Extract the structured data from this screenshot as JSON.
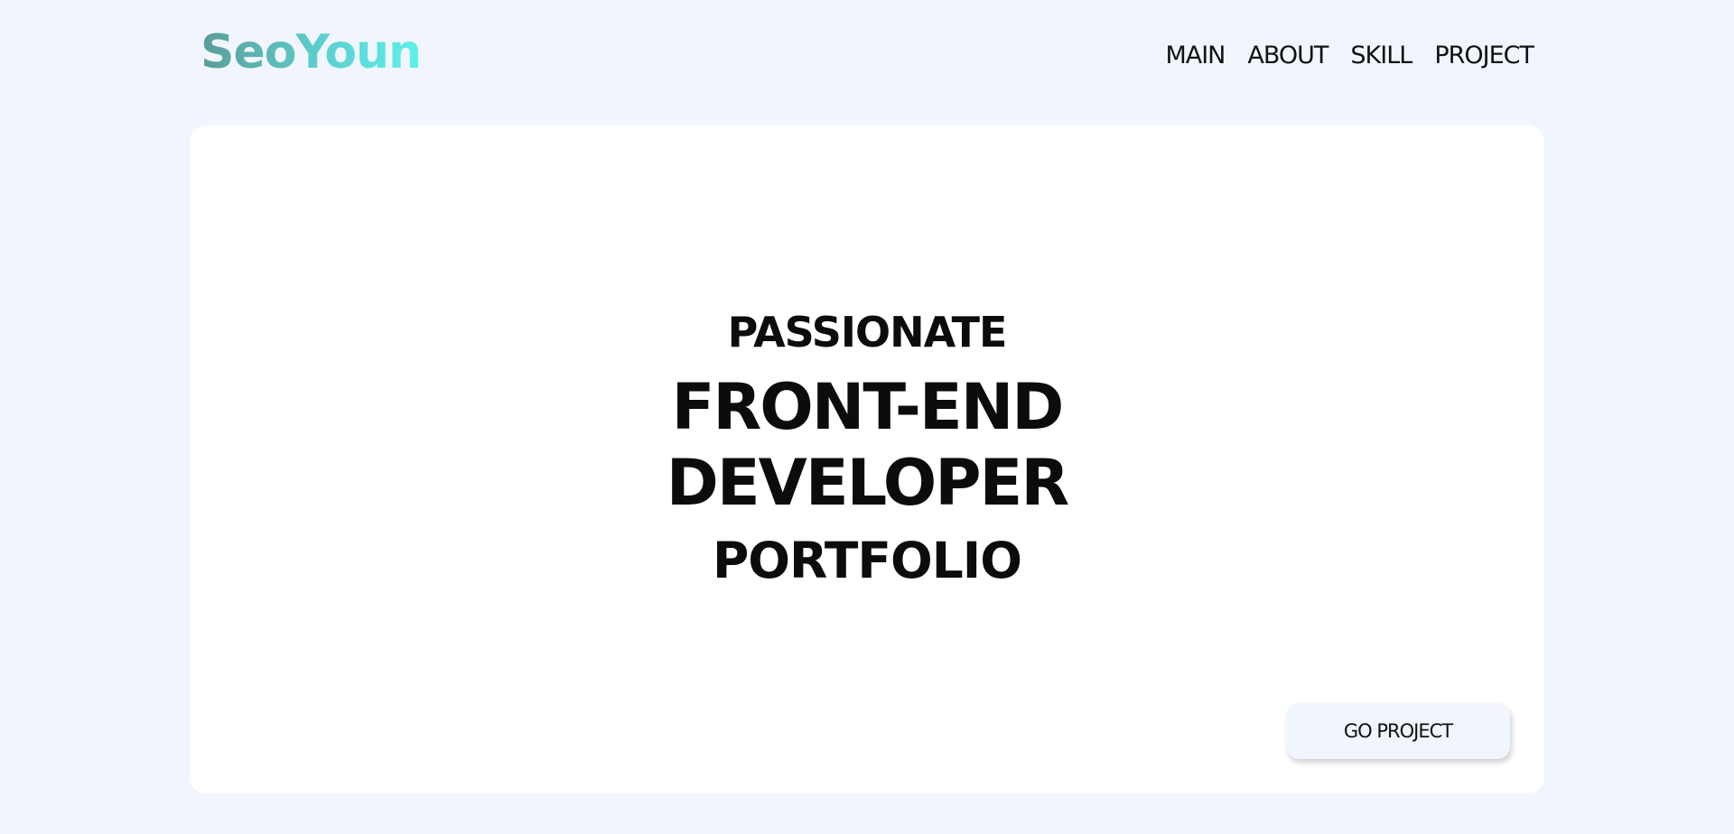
{
  "header": {
    "logo": "SeoYoun",
    "nav": [
      "MAIN",
      "ABOUT",
      "SKILL",
      "PROJECT"
    ]
  },
  "hero": {
    "line1": "PASSIONATE",
    "line2": "FRONT-END",
    "line3": "DEVELOPER",
    "line4": "PORTFOLIO",
    "cta_label": "GO PROJECT"
  },
  "colors": {
    "page_background": "#f1f6fe",
    "card_background": "#ffffff",
    "logo_gradient_start": "#5b9c98",
    "logo_gradient_end": "#5ef0ec",
    "button_background": "#f1f5fd"
  }
}
